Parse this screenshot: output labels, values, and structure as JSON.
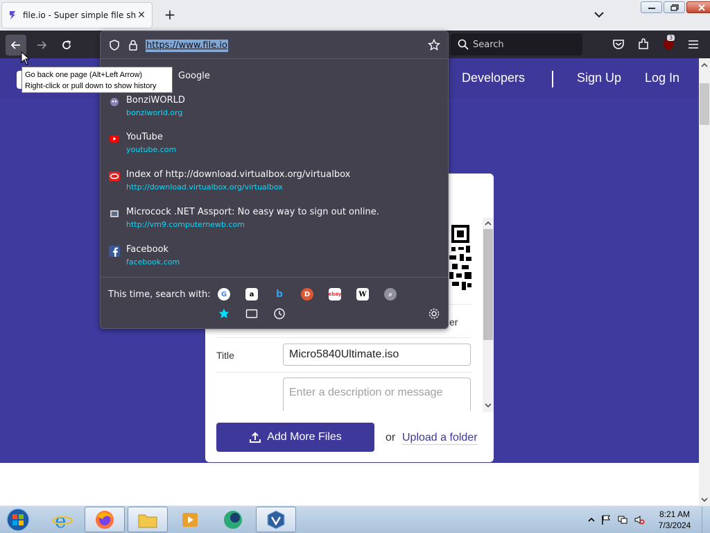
{
  "browser": {
    "tab_title": "file.io - Super simple file sharing",
    "new_tab_icon": "plus-icon",
    "url": "https://www.file.io",
    "search_placeholder": "Search",
    "extension_badge": "3"
  },
  "tooltip": {
    "line1": "Go back one page (Alt+Left Arrow)",
    "line2": "Right-click or pull down to show history"
  },
  "url_dropdown": {
    "google_row": "Google",
    "results": [
      {
        "title": "BonziWORLD",
        "url": "bonziworld.org",
        "icon": "bonzi-icon"
      },
      {
        "title": "YouTube",
        "url": "youtube.com",
        "icon": "youtube-icon"
      },
      {
        "title": "Index of http://download.virtualbox.org/virtualbox",
        "url": "http://download.virtualbox.org/virtualbox",
        "icon": "oracle-icon"
      },
      {
        "title": "Microcock .NET Assport: No easy way to sign out online.",
        "url": "http://vm9.computernewb.com",
        "icon": "passport-icon"
      },
      {
        "title": "Facebook",
        "url": "facebook.com",
        "icon": "facebook-icon"
      }
    ],
    "search_with_label": "This time, search with:",
    "engines": [
      "google",
      "amazon",
      "bing",
      "duckduckgo",
      "ebay",
      "wikipedia",
      "search",
      "bookmarks",
      "tabs",
      "history"
    ]
  },
  "page": {
    "nav": {
      "developers": "Developers",
      "sign_up": "Sign Up",
      "log_in": "Log In"
    },
    "card": {
      "partial_text": "er",
      "title_label": "Title",
      "title_value": "Micro5840Ultimate.iso",
      "description_placeholder": "Enter a description or message",
      "add_files_label": "Add More Files",
      "or_label": "or",
      "upload_folder_label": "Upload a folder"
    }
  },
  "taskbar": {
    "time": "8:21 AM",
    "date": "7/3/2024",
    "apps": [
      "internet-explorer",
      "firefox",
      "file-explorer",
      "media-player",
      "browser-globe",
      "virtualbox"
    ]
  },
  "colors": {
    "brand_purple": "#3d3899",
    "toolbar_dark": "#2b2a33",
    "panel_bg": "#42414d",
    "url_link": "#00ddff"
  }
}
